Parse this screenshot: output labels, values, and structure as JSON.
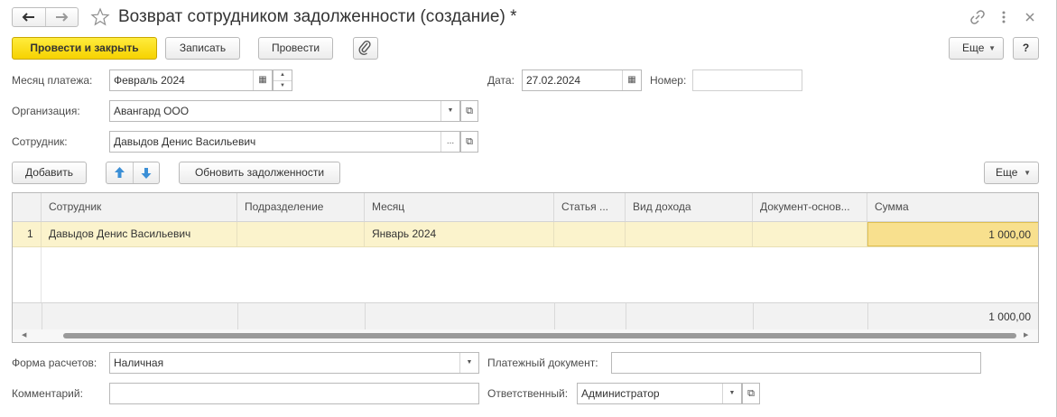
{
  "window": {
    "title": "Возврат сотрудником задолженности (создание) *",
    "nav_back_icon": "arrow-left-icon",
    "nav_forward_icon": "arrow-right-icon",
    "favorite_icon": "star-icon",
    "link_icon": "link-icon",
    "more_icon": "vertical-dots-icon",
    "close_icon": "close-icon"
  },
  "toolbar": {
    "post_close": "Провести и закрыть",
    "save": "Записать",
    "post": "Провести",
    "attach_icon": "paperclip-icon",
    "more": "Еще",
    "help": "?"
  },
  "form": {
    "month_label": "Месяц платежа:",
    "month_value": "Февраль 2024",
    "date_label": "Дата:",
    "date_value": "27.02.2024",
    "number_label": "Номер:",
    "number_value": "",
    "org_label": "Организация:",
    "org_value": "Авангард ООО",
    "employee_label": "Сотрудник:",
    "employee_value": "Давыдов Денис Васильевич"
  },
  "table_toolbar": {
    "add": "Добавить",
    "refresh": "Обновить задолженности",
    "more": "Еще"
  },
  "table": {
    "columns": [
      "",
      "Сотрудник",
      "Подразделение",
      "Месяц",
      "Статья ...",
      "Вид дохода",
      "Документ-основ...",
      "Сумма"
    ],
    "rows": [
      {
        "n": "1",
        "employee": "Давыдов Денис Васильевич",
        "department": "",
        "month": "Январь 2024",
        "article": "",
        "income_type": "",
        "basis_doc": "",
        "amount": "1 000,00"
      }
    ],
    "total": "1 000,00"
  },
  "bottom": {
    "payment_form_label": "Форма расчетов:",
    "payment_form_value": "Наличная",
    "payment_doc_label": "Платежный документ:",
    "payment_doc_value": "",
    "comment_label": "Комментарий:",
    "comment_value": "",
    "responsible_label": "Ответственный:",
    "responsible_value": "Администратор"
  },
  "colors": {
    "primary_button": "#f6d200",
    "selected_row": "#fbf3cc",
    "selected_cell": "#f8e08e"
  }
}
